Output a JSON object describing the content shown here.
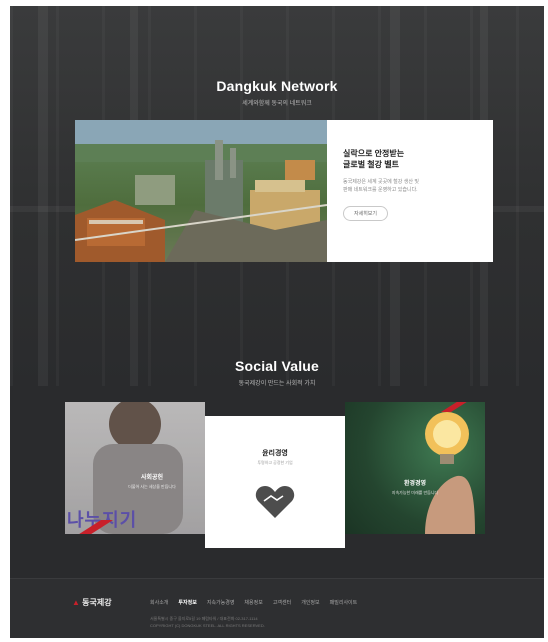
{
  "network": {
    "title": "Dangkuk Network",
    "subtitle": "세계와함께 동국의 네트워크",
    "heading_line1": "실락으로 안정받는",
    "heading_line2": "글로벌 철강 벨트",
    "desc_line1": "동국제강은 세계 곳곳에 철강 생산 및",
    "desc_line2": "판매 네트워크를 운영하고 있습니다.",
    "more_label": "자세히보기"
  },
  "social": {
    "title": "Social Value",
    "subtitle": "동국제강이 만드는 사회적 가치",
    "left_title": "사회공헌",
    "left_sub": "더불어 사는 세상을 만듭니다",
    "left_big": "나누지기",
    "mid_title": "윤리경영",
    "mid_sub": "투명하고 공정한 기업",
    "right_title": "환경경영",
    "right_sub": "지속가능한 미래를 만듭니다"
  },
  "footer": {
    "logo_text": "동국제강",
    "nav": [
      "회사소개",
      "투자정보",
      "지속가능경영",
      "채용정보",
      "고객센터",
      "개인정보",
      "패밀리사이트"
    ],
    "copy_line1": "서울특별시 중구 을지로5길 19 페럼타워 / 대표전화 02-317-1114",
    "copy_line2": "COPYRIGHT (C) DONGKUK STEEL. ALL RIGHTS RESERVED."
  },
  "colors": {
    "background": "#2a2b2d",
    "accent_red": "#c8202a",
    "heart": "#4d4d4d"
  }
}
